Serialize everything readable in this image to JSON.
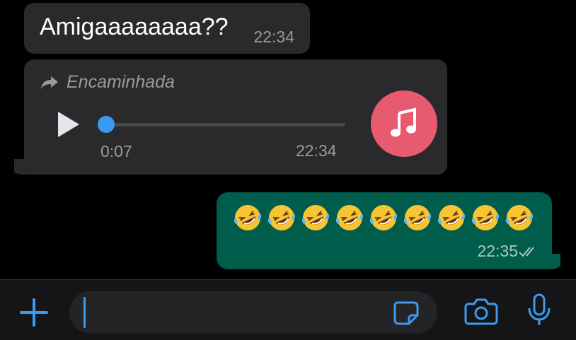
{
  "conversation": {
    "messages": [
      {
        "direction": "incoming",
        "text": "Amigaaaaaaaa??",
        "time": "22:34"
      },
      {
        "direction": "incoming",
        "type": "audio",
        "forwarded_label": "Encaminhada",
        "duration": "0:07",
        "time": "22:34",
        "progress": 0.0
      },
      {
        "direction": "outgoing",
        "text": "🤣🤣🤣🤣🤣🤣🤣🤣🤣",
        "emoji_count": 9,
        "time": "22:35",
        "status": "read"
      }
    ]
  },
  "input": {
    "placeholder": "",
    "value": ""
  },
  "colors": {
    "accent": "#3a9bf0",
    "outgoing_bubble": "#005c4b",
    "incoming_bubble": "#2a2a2c",
    "music": "#e85a6f"
  },
  "icons": [
    "plus-icon",
    "sticker-icon",
    "camera-icon",
    "mic-icon",
    "play-icon",
    "forward-icon",
    "music-icon",
    "double-check-icon"
  ]
}
